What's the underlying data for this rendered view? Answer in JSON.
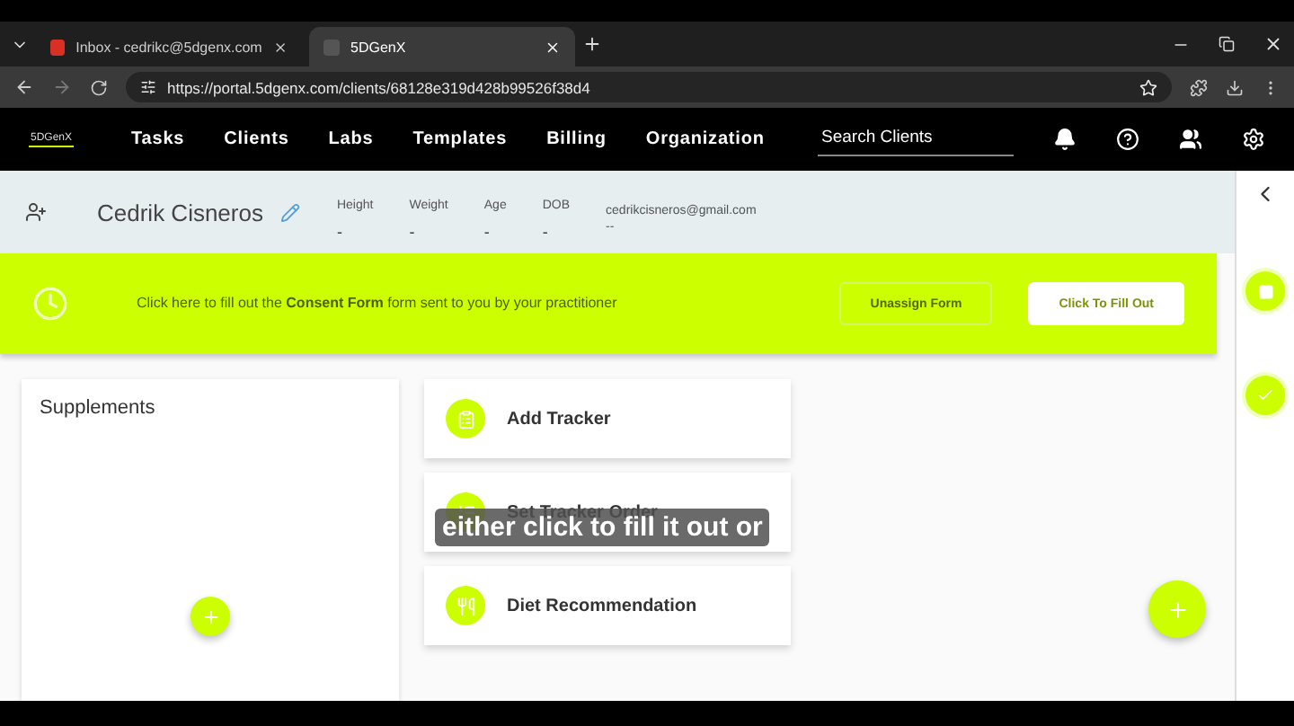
{
  "browser": {
    "tabs": [
      {
        "title": "Inbox - cedrikc@5dgenx.com",
        "selected": false
      },
      {
        "title": "5DGenX",
        "selected": true
      }
    ],
    "url": "https://portal.5dgenx.com/clients/68128e319d428b99526f38d4"
  },
  "nav": {
    "logo": "5DGenX",
    "items": [
      "Tasks",
      "Clients",
      "Labs",
      "Templates",
      "Billing",
      "Organization"
    ],
    "search": {
      "placeholder": "Search Clients"
    }
  },
  "profile": {
    "name": "Cedrik Cisneros",
    "fields": [
      {
        "label": "Height",
        "value": "-"
      },
      {
        "label": "Weight",
        "value": "-"
      },
      {
        "label": "Age",
        "value": "-"
      },
      {
        "label": "DOB",
        "value": "-"
      }
    ],
    "email": "cedrikcisneros@gmail.com",
    "email_note": "--"
  },
  "banner": {
    "text": "Click here to fill out the **Consent Form** form sent to you by your practitioner",
    "buttons": [
      {
        "label": "Unassign Form",
        "kind": "outline"
      },
      {
        "label": "Click To Fill Out",
        "kind": "filled"
      }
    ]
  },
  "supplements": {
    "title": "Supplements"
  },
  "actions": [
    {
      "label": "Add Tracker"
    },
    {
      "label": "Set Tracker Order"
    },
    {
      "label": "Diet Recommendation"
    }
  ],
  "caption": "either click to fill it out or"
}
